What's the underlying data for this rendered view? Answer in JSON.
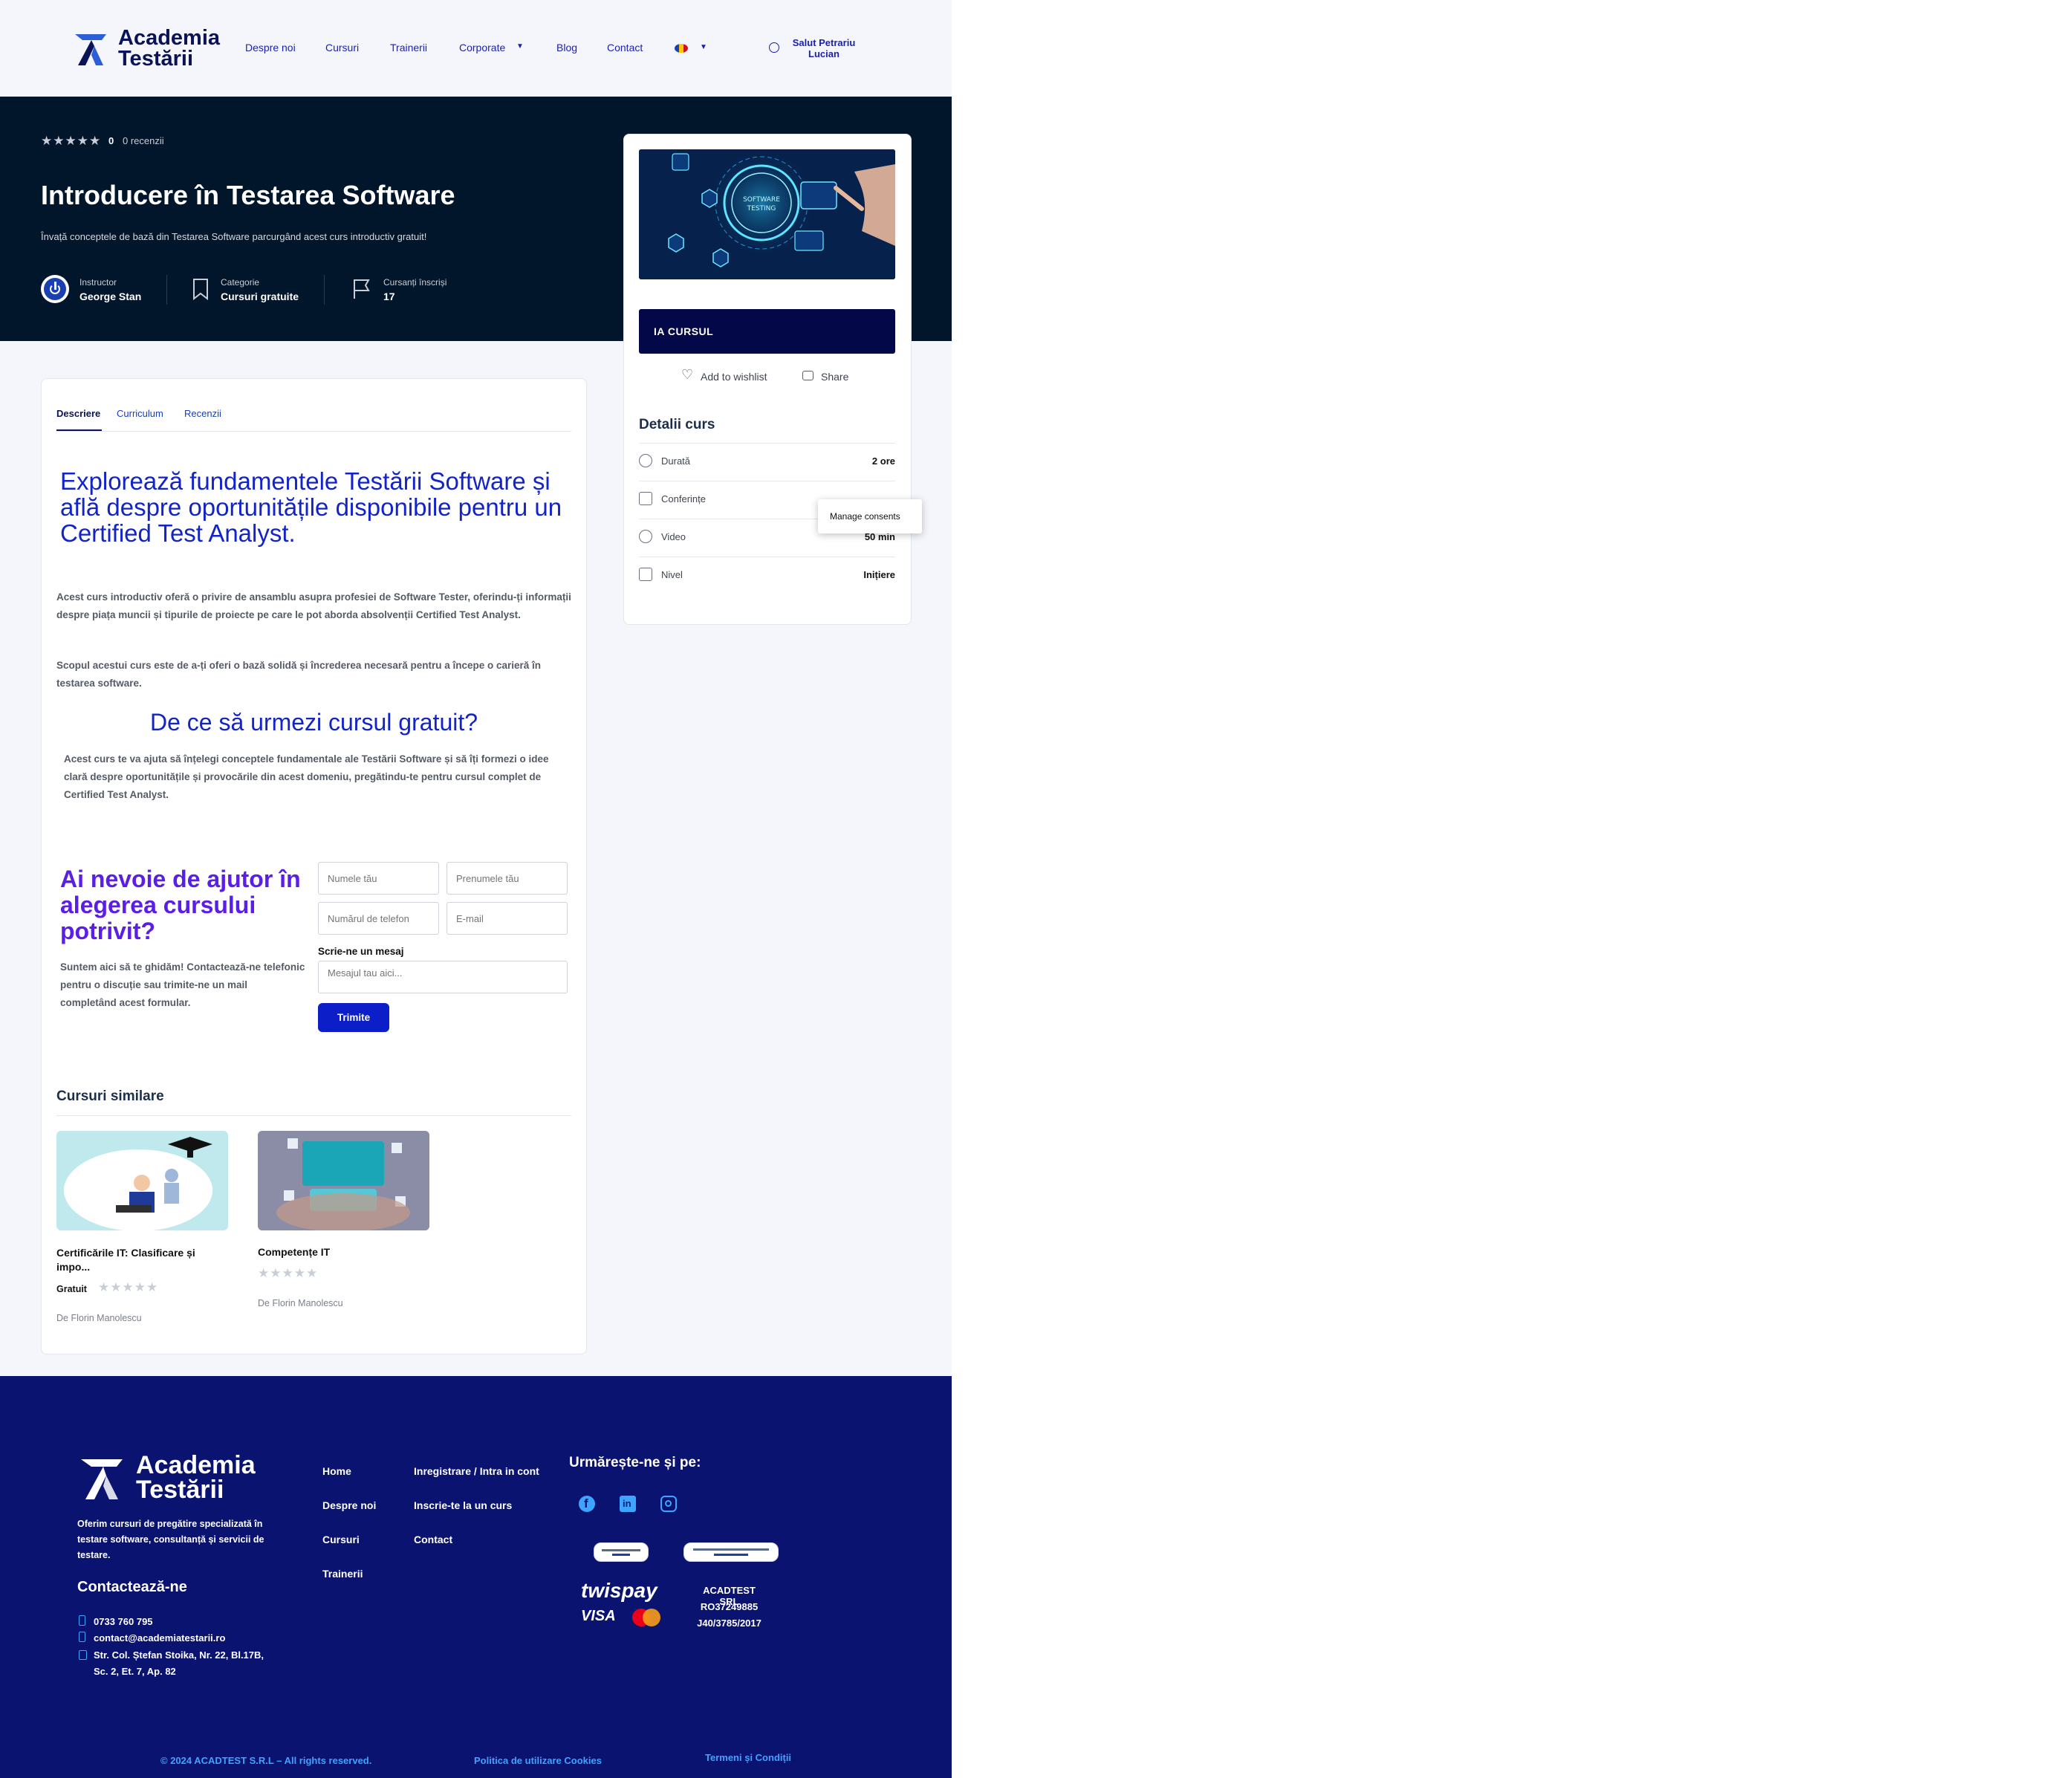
{
  "header": {
    "logo_line1": "Academia",
    "logo_line2": "Testării",
    "nav": [
      "Despre noi",
      "Cursuri",
      "Trainerii",
      "Corporate",
      "Blog",
      "Contact"
    ],
    "user_greeting_line1": "Salut Petrariu",
    "user_greeting_line2": "Lucian"
  },
  "hero": {
    "rating_value": "0",
    "reviews": "0 recenzii",
    "title": "Introducere în Testarea Software",
    "subtitle": "Învață conceptele de bază din Testarea Software parcurgând acest curs introductiv gratuit!",
    "instructor_label": "Instructor",
    "instructor_value": "George Stan",
    "category_label": "Categorie",
    "category_value": "Cursuri gratuite",
    "enrolled_label": "Cursanți înscriși",
    "enrolled_value": "17"
  },
  "tabs": [
    "Descriere",
    "Curriculum",
    "Recenzii"
  ],
  "content": {
    "heading": "Explorează fundamentele Testării Software și află despre oportunitățile disponibile pentru un Certified Test Analyst.",
    "para1": "Acest curs introductiv oferă o privire de ansamblu asupra profesiei de Software Tester, oferindu-ți informații despre piața muncii și tipurile de proiecte pe care le pot aborda absolvenții Certified Test Analyst.",
    "para2": "Scopul acestui curs este de a-ți oferi o bază solidă și încrederea necesară pentru a începe o carieră în testarea software.",
    "why_heading": "De ce să urmezi cursul gratuit?",
    "why_para": "Acest curs te va ajuta să înțelegi conceptele fundamentale ale Testării Software și să îți formezi o idee clară despre oportunitățile și provocările din acest domeniu, pregătindu-te pentru cursul complet de Certified Test Analyst."
  },
  "help": {
    "heading": "Ai nevoie de ajutor în alegerea cursului potrivit?",
    "text": "Suntem aici să te ghidăm! Contactează-ne telefonic pentru o discuție sau trimite-ne un mail completând acest formular.",
    "ph_name": "Numele tău",
    "ph_firstname": "Prenumele tău",
    "ph_phone": "Numărul de telefon",
    "ph_email": "E-mail",
    "message_label": "Scrie-ne un mesaj",
    "ph_message": "Mesajul tau aici...",
    "submit": "Trimite"
  },
  "similar": {
    "heading": "Cursuri similare",
    "courses": [
      {
        "title_l1": "Certificările IT: Clasificare și",
        "title_l2": "impo...",
        "price": "Gratuit",
        "author": "De Florin Manolescu"
      },
      {
        "title_l1": "Competențe IT",
        "title_l2": "",
        "price": "",
        "author": "De Florin Manolescu"
      }
    ]
  },
  "sidebar": {
    "image_text_l1": "SOFTWARE",
    "image_text_l2": "TESTING",
    "cta": "IA CURSUL",
    "wishlist": "Add to wishlist",
    "share": "Share",
    "details_heading": "Detalii curs",
    "details": [
      {
        "label": "Durată",
        "value": "2 ore",
        "icon": "clock-icon"
      },
      {
        "label": "Conferințe",
        "value": "",
        "icon": "book-icon"
      },
      {
        "label": "Video",
        "value": "50 min",
        "icon": "play-icon"
      },
      {
        "label": "Nivel",
        "value": "Inițiere",
        "icon": "level-icon"
      }
    ],
    "consent_tooltip": "Manage consents"
  },
  "footer": {
    "logo_line1": "Academia",
    "logo_line2": "Testării",
    "about": "Oferim cursuri de pregătire specializată în testare software, consultanță și servicii de testare.",
    "contact_heading": "Contactează-ne",
    "phone": "0733 760 795",
    "email": "contact@academiatestarii.ro",
    "address_l1": "Str. Col. Ștefan Stoika, Nr. 22, Bl.17B,",
    "address_l2": "Sc. 2, Et. 7, Ap. 82",
    "links_col1": [
      "Home",
      "Despre noi",
      "Cursuri",
      "Trainerii"
    ],
    "links_col2": [
      "Inregistrare / Intra in cont",
      "Inscrie-te la un curs",
      "Contact"
    ],
    "follow_heading": "Urmărește-ne și pe:",
    "payment_brand": "twispay",
    "company_l1": "ACADTEST SRL",
    "company_l2": "RO37249885",
    "company_l3": "J40/3785/2017",
    "copyright": "© 2024 ACADTEST S.R.L – All rights reserved.",
    "cookies": "Politica de utilizare Cookies",
    "terms": "Termeni și Condiții"
  },
  "colors": {
    "hero_bg": "#02162b",
    "footer_bg": "#0a1370",
    "cta_bg": "#030848",
    "heading_blue": "#1224c8",
    "help_purple": "#5b1ee6",
    "link_blue": "#3fa4ff"
  }
}
